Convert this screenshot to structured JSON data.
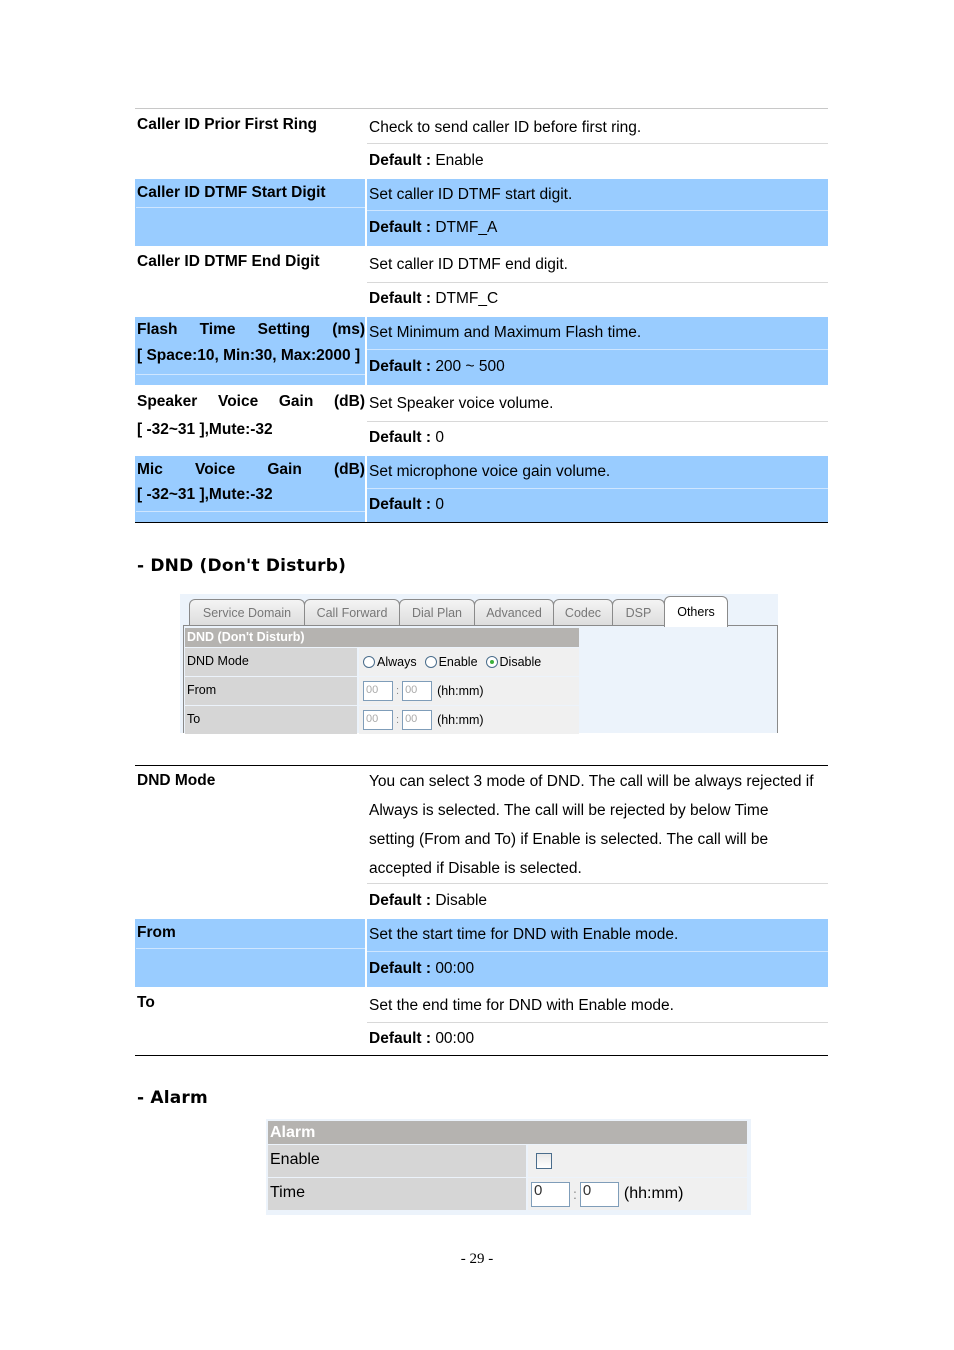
{
  "default_label": "Default :",
  "table1": {
    "rows": [
      {
        "name_lines": [
          "Caller ID Prior First Ring"
        ],
        "description": "Check to send caller ID before first ring.",
        "default": "Enable",
        "highlight": false
      },
      {
        "name_lines": [
          "Caller ID DTMF Start Digit"
        ],
        "description": "Set caller ID DTMF start digit.",
        "default": "DTMF_A",
        "highlight": true
      },
      {
        "name_lines": [
          "Caller ID DTMF End Digit"
        ],
        "description": "Set caller ID DTMF end digit.",
        "default": "DTMF_C",
        "highlight": false
      },
      {
        "name_words": [
          "Flash",
          "Time",
          "Setting",
          "(ms)"
        ],
        "name_lines": [
          "Flash Time Setting (ms)",
          "[ Space:10, Min:30, Max:2000 ]"
        ],
        "description": "Set Minimum and Maximum Flash time.",
        "default": "200 ~ 500",
        "highlight": true
      },
      {
        "name_words": [
          "Speaker",
          "Voice",
          "Gain",
          "(dB)"
        ],
        "name_lines": [
          "Speaker Voice Gain (dB)",
          "[ -32~31 ],Mute:-32"
        ],
        "description": "Set Speaker voice volume.",
        "default": "0",
        "highlight": false
      },
      {
        "name_words": [
          "Mic",
          "Voice",
          "Gain",
          "(dB)"
        ],
        "name_lines": [
          "Mic Voice Gain (dB)",
          "[ -32~31 ],Mute:-32"
        ],
        "description": "Set microphone voice gain volume.",
        "default": "0",
        "highlight": true
      }
    ]
  },
  "dnd_section": {
    "title": "- DND (Don't Disturb)",
    "screenshot": {
      "tabs": [
        "Service Domain",
        "Call Forward",
        "Dial Plan",
        "Advanced",
        "Codec",
        "DSP",
        "Others"
      ],
      "active_tab": "Others",
      "form_title": "DND (Don't Disturb)",
      "mode_label": "DND Mode",
      "mode_options": [
        "Always",
        "Enable",
        "Disable"
      ],
      "mode_selected": "Disable",
      "from_label": "From",
      "to_label": "To",
      "from_hh": "00",
      "from_mm": "00",
      "to_hh": "00",
      "to_mm": "00",
      "colon": ":",
      "format_hint": "(hh:mm)"
    },
    "table": {
      "rows": [
        {
          "name": "DND Mode",
          "description_lines": [
            "You can select 3 mode of DND. The call will be always rejected if",
            "Always is selected. The call will be rejected by below Time",
            "setting (From and To) if Enable is selected. The call will be",
            "accepted if Disable is selected."
          ],
          "default": "Disable",
          "highlight": false
        },
        {
          "name": "From",
          "description": "Set the start time for DND with Enable mode.",
          "default": "00:00",
          "highlight": true
        },
        {
          "name": "To",
          "description": "Set the end time for DND with Enable mode.",
          "default": "00:00",
          "highlight": false
        }
      ]
    }
  },
  "alarm_section": {
    "title": "- Alarm",
    "screenshot": {
      "form_title": "Alarm",
      "enable_label": "Enable",
      "enable_checked": false,
      "time_label": "Time",
      "time_hh": "0",
      "time_mm": "0",
      "colon": ":",
      "format_hint": "(hh:mm)"
    }
  },
  "page_number": "- 29 -"
}
